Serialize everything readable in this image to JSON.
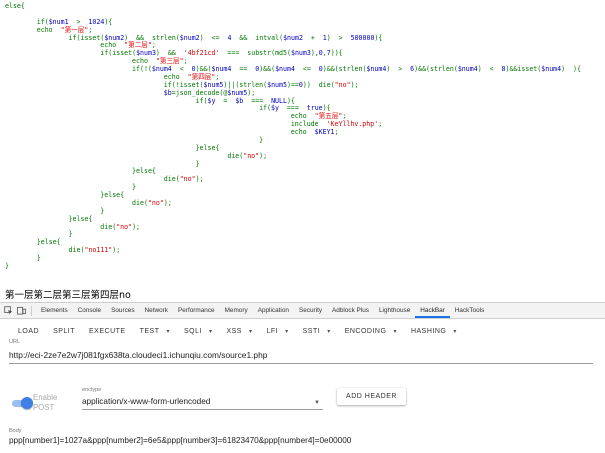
{
  "code_lines": [
    [
      {
        "t": "else",
        "c": "key"
      },
      {
        "t": "{",
        "c": "key"
      }
    ],
    [],
    [
      {
        "t": "        "
      },
      {
        "t": "if",
        "c": "key"
      },
      {
        "t": "(",
        "c": "key"
      },
      {
        "t": "$num1",
        "c": "var"
      },
      {
        "t": "  >  ",
        "c": "key"
      },
      {
        "t": "1024",
        "c": "var"
      },
      {
        "t": "){",
        "c": "key"
      }
    ],
    [
      {
        "t": "        "
      },
      {
        "t": "echo",
        "c": "key"
      },
      {
        "t": "  "
      },
      {
        "t": "\"第一层\"",
        "c": "str"
      },
      {
        "t": ";",
        "c": "key"
      }
    ],
    [
      {
        "t": "                "
      },
      {
        "t": "if",
        "c": "key"
      },
      {
        "t": "(",
        "c": "key"
      },
      {
        "t": "isset",
        "c": "key"
      },
      {
        "t": "(",
        "c": "key"
      },
      {
        "t": "$num2",
        "c": "var"
      },
      {
        "t": ")  &&  ",
        "c": "key"
      },
      {
        "t": "strlen",
        "c": "key"
      },
      {
        "t": "(",
        "c": "key"
      },
      {
        "t": "$num2",
        "c": "var"
      },
      {
        "t": ")  <=  ",
        "c": "key"
      },
      {
        "t": "4",
        "c": "var"
      },
      {
        "t": "  &&  ",
        "c": "key"
      },
      {
        "t": "intval",
        "c": "key"
      },
      {
        "t": "(",
        "c": "key"
      },
      {
        "t": "$num2",
        "c": "var"
      },
      {
        "t": "  +  ",
        "c": "key"
      },
      {
        "t": "1",
        "c": "var"
      },
      {
        "t": ")  >  ",
        "c": "key"
      },
      {
        "t": "500000",
        "c": "var"
      },
      {
        "t": "){",
        "c": "key"
      }
    ],
    [
      {
        "t": "                        "
      },
      {
        "t": "echo",
        "c": "key"
      },
      {
        "t": "  "
      },
      {
        "t": "\"第二层\"",
        "c": "str"
      },
      {
        "t": ";",
        "c": "key"
      }
    ],
    [
      {
        "t": "                        "
      },
      {
        "t": "if",
        "c": "key"
      },
      {
        "t": "(",
        "c": "key"
      },
      {
        "t": "isset",
        "c": "key"
      },
      {
        "t": "(",
        "c": "key"
      },
      {
        "t": "$num3",
        "c": "var"
      },
      {
        "t": ")  &&  ",
        "c": "key"
      },
      {
        "t": "'4bf21cd'",
        "c": "str"
      },
      {
        "t": "  ===  ",
        "c": "key"
      },
      {
        "t": "substr",
        "c": "key"
      },
      {
        "t": "(",
        "c": "key"
      },
      {
        "t": "md5",
        "c": "key"
      },
      {
        "t": "(",
        "c": "key"
      },
      {
        "t": "$num3",
        "c": "var"
      },
      {
        "t": "),",
        "c": "key"
      },
      {
        "t": "0",
        "c": "var"
      },
      {
        "t": ",",
        "c": "key"
      },
      {
        "t": "7",
        "c": "var"
      },
      {
        "t": ")){",
        "c": "key"
      }
    ],
    [
      {
        "t": "                                "
      },
      {
        "t": "echo",
        "c": "key"
      },
      {
        "t": "  "
      },
      {
        "t": "\"第三层\"",
        "c": "str"
      },
      {
        "t": ";",
        "c": "key"
      }
    ],
    [
      {
        "t": "                                "
      },
      {
        "t": "if",
        "c": "key"
      },
      {
        "t": "(!(",
        "c": "key"
      },
      {
        "t": "$num4",
        "c": "var"
      },
      {
        "t": "  <  ",
        "c": "key"
      },
      {
        "t": "0",
        "c": "var"
      },
      {
        "t": ")&&(",
        "c": "key"
      },
      {
        "t": "$num4",
        "c": "var"
      },
      {
        "t": "  ==  ",
        "c": "key"
      },
      {
        "t": "0",
        "c": "var"
      },
      {
        "t": ")&&(",
        "c": "key"
      },
      {
        "t": "$num4",
        "c": "var"
      },
      {
        "t": "  <=  ",
        "c": "key"
      },
      {
        "t": "0",
        "c": "var"
      },
      {
        "t": ")&&(",
        "c": "key"
      },
      {
        "t": "strlen",
        "c": "key"
      },
      {
        "t": "(",
        "c": "key"
      },
      {
        "t": "$num4",
        "c": "var"
      },
      {
        "t": ")  >  ",
        "c": "key"
      },
      {
        "t": "6",
        "c": "var"
      },
      {
        "t": ")&&(",
        "c": "key"
      },
      {
        "t": "strlen",
        "c": "key"
      },
      {
        "t": "(",
        "c": "key"
      },
      {
        "t": "$num4",
        "c": "var"
      },
      {
        "t": ")  <  ",
        "c": "key"
      },
      {
        "t": "8",
        "c": "var"
      },
      {
        "t": ")&&",
        "c": "key"
      },
      {
        "t": "isset",
        "c": "key"
      },
      {
        "t": "(",
        "c": "key"
      },
      {
        "t": "$num4",
        "c": "var"
      },
      {
        "t": ")  ){",
        "c": "key"
      }
    ],
    [
      {
        "t": "                                        "
      },
      {
        "t": "echo",
        "c": "key"
      },
      {
        "t": "  "
      },
      {
        "t": "\"第四层\"",
        "c": "str"
      },
      {
        "t": ";",
        "c": "key"
      }
    ],
    [
      {
        "t": "                                        "
      },
      {
        "t": "if",
        "c": "key"
      },
      {
        "t": "(!",
        "c": "key"
      },
      {
        "t": "isset",
        "c": "key"
      },
      {
        "t": "(",
        "c": "key"
      },
      {
        "t": "$num5",
        "c": "var"
      },
      {
        "t": ")||(",
        "c": "key"
      },
      {
        "t": "strlen",
        "c": "key"
      },
      {
        "t": "(",
        "c": "key"
      },
      {
        "t": "$num5",
        "c": "var"
      },
      {
        "t": ")==",
        "c": "key"
      },
      {
        "t": "0",
        "c": "var"
      },
      {
        "t": "))  ",
        "c": "key"
      },
      {
        "t": "die",
        "c": "key"
      },
      {
        "t": "(",
        "c": "key"
      },
      {
        "t": "\"no\"",
        "c": "str"
      },
      {
        "t": ");",
        "c": "key"
      }
    ],
    [
      {
        "t": "                                        "
      },
      {
        "t": "$b",
        "c": "var"
      },
      {
        "t": "=",
        "c": "key"
      },
      {
        "t": "json_decode",
        "c": "key"
      },
      {
        "t": "(@",
        "c": "key"
      },
      {
        "t": "$num5",
        "c": "var"
      },
      {
        "t": ");",
        "c": "key"
      }
    ],
    [
      {
        "t": "                                                "
      },
      {
        "t": "if",
        "c": "key"
      },
      {
        "t": "(",
        "c": "key"
      },
      {
        "t": "$y",
        "c": "var"
      },
      {
        "t": "  =  ",
        "c": "key"
      },
      {
        "t": "$b",
        "c": "var"
      },
      {
        "t": "  ===  ",
        "c": "key"
      },
      {
        "t": "NULL",
        "c": "var"
      },
      {
        "t": "){",
        "c": "key"
      }
    ],
    [
      {
        "t": "                                                                "
      },
      {
        "t": "if",
        "c": "key"
      },
      {
        "t": "(",
        "c": "key"
      },
      {
        "t": "$y",
        "c": "var"
      },
      {
        "t": "  ===  ",
        "c": "key"
      },
      {
        "t": "true",
        "c": "var"
      },
      {
        "t": "){",
        "c": "key"
      }
    ],
    [
      {
        "t": "                                                                        "
      },
      {
        "t": "echo",
        "c": "key"
      },
      {
        "t": "  "
      },
      {
        "t": "\"第五层\"",
        "c": "str"
      },
      {
        "t": ";",
        "c": "key"
      }
    ],
    [
      {
        "t": "                                                                        "
      },
      {
        "t": "include",
        "c": "key"
      },
      {
        "t": "  "
      },
      {
        "t": "'KeYllhv.php'",
        "c": "str"
      },
      {
        "t": ";",
        "c": "key"
      }
    ],
    [
      {
        "t": "                                                                        "
      },
      {
        "t": "echo",
        "c": "key"
      },
      {
        "t": "  "
      },
      {
        "t": "$KEY1",
        "c": "var"
      },
      {
        "t": ";",
        "c": "key"
      }
    ],
    [
      {
        "t": "                                                                "
      },
      {
        "t": "}",
        "c": "key"
      }
    ],
    [
      {
        "t": "                                                "
      },
      {
        "t": "}",
        "c": "key"
      },
      {
        "t": "else",
        "c": "key"
      },
      {
        "t": "{",
        "c": "key"
      }
    ],
    [
      {
        "t": "                                                        "
      },
      {
        "t": "die",
        "c": "key"
      },
      {
        "t": "(",
        "c": "key"
      },
      {
        "t": "\"no\"",
        "c": "str"
      },
      {
        "t": ");",
        "c": "key"
      }
    ],
    [
      {
        "t": "                                                "
      },
      {
        "t": "}",
        "c": "key"
      }
    ],
    [
      {
        "t": "                                "
      },
      {
        "t": "}",
        "c": "key"
      },
      {
        "t": "else",
        "c": "key"
      },
      {
        "t": "{",
        "c": "key"
      }
    ],
    [
      {
        "t": "                                        "
      },
      {
        "t": "die",
        "c": "key"
      },
      {
        "t": "(",
        "c": "key"
      },
      {
        "t": "\"no\"",
        "c": "str"
      },
      {
        "t": ");",
        "c": "key"
      }
    ],
    [
      {
        "t": "                                "
      },
      {
        "t": "}",
        "c": "key"
      }
    ],
    [
      {
        "t": "                        "
      },
      {
        "t": "}",
        "c": "key"
      },
      {
        "t": "else",
        "c": "key"
      },
      {
        "t": "{",
        "c": "key"
      }
    ],
    [
      {
        "t": "                                "
      },
      {
        "t": "die",
        "c": "key"
      },
      {
        "t": "(",
        "c": "key"
      },
      {
        "t": "\"no\"",
        "c": "str"
      },
      {
        "t": ");",
        "c": "key"
      }
    ],
    [
      {
        "t": "                        "
      },
      {
        "t": "}",
        "c": "key"
      }
    ],
    [
      {
        "t": "                "
      },
      {
        "t": "}",
        "c": "key"
      },
      {
        "t": "else",
        "c": "key"
      },
      {
        "t": "{",
        "c": "key"
      }
    ],
    [
      {
        "t": "                        "
      },
      {
        "t": "die",
        "c": "key"
      },
      {
        "t": "(",
        "c": "key"
      },
      {
        "t": "\"no\"",
        "c": "str"
      },
      {
        "t": ");",
        "c": "key"
      }
    ],
    [
      {
        "t": "                "
      },
      {
        "t": "}",
        "c": "key"
      }
    ],
    [
      {
        "t": "        "
      },
      {
        "t": "}",
        "c": "key"
      },
      {
        "t": "else",
        "c": "key"
      },
      {
        "t": "{",
        "c": "key"
      }
    ],
    [
      {
        "t": "                "
      },
      {
        "t": "die",
        "c": "key"
      },
      {
        "t": "(",
        "c": "key"
      },
      {
        "t": "\"no111\"",
        "c": "str"
      },
      {
        "t": ");",
        "c": "key"
      }
    ],
    [
      {
        "t": "        "
      },
      {
        "t": "}",
        "c": "key"
      }
    ],
    [
      {
        "t": "}",
        "c": "key"
      }
    ]
  ],
  "output_text": "第一层第二层第三层第四层no",
  "devtools": {
    "tabs": [
      "Elements",
      "Console",
      "Sources",
      "Network",
      "Performance",
      "Memory",
      "Application",
      "Security",
      "Adblock Plus",
      "Lighthouse",
      "HackBar",
      "HackTools"
    ],
    "active_tab": "HackBar"
  },
  "hackbar": {
    "toolbar": [
      {
        "label": "LOAD",
        "dropdown": false
      },
      {
        "label": "SPLIT",
        "dropdown": false
      },
      {
        "label": "EXECUTE",
        "dropdown": false
      },
      {
        "label": "TEST",
        "dropdown": true
      },
      {
        "label": "SQLI",
        "dropdown": true
      },
      {
        "label": "XSS",
        "dropdown": true
      },
      {
        "label": "LFI",
        "dropdown": true
      },
      {
        "label": "SSTI",
        "dropdown": true
      },
      {
        "label": "ENCODING",
        "dropdown": true
      },
      {
        "label": "HASHING",
        "dropdown": true
      }
    ],
    "url_label": "URL",
    "url": "http://eci-2ze7e2w7j081fgx638ta.cloudeci1.ichunqiu.com/source1.php",
    "enable_post_label": "Enable POST",
    "enable_post": true,
    "enctype_label": "enctype",
    "enctype_value": "application/x-www-form-urlencoded",
    "add_header_label": "ADD HEADER",
    "body_label": "Body",
    "body_value": "ppp[number1]=1027a&ppp[number2]=6e5&ppp[number3]=61823470&ppp[number4]=0e00000"
  },
  "colors": {
    "keyword": "#007700",
    "variable": "#0000bb",
    "string": "#dd0000",
    "accent": "#1a73e8",
    "toggle": "#3f7fe6"
  }
}
